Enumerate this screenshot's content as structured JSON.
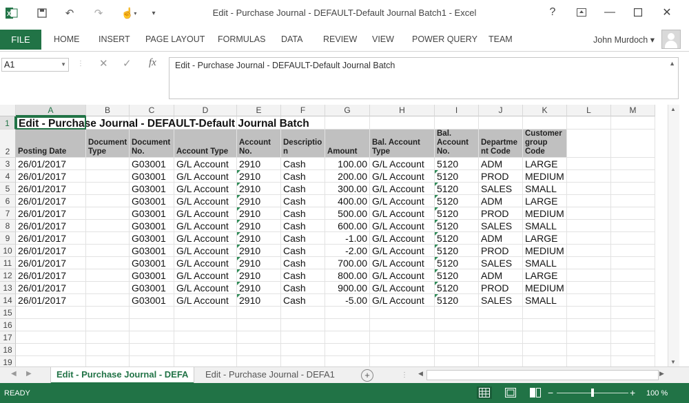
{
  "window": {
    "title": "Edit - Purchase Journal - DEFAULT-Default Journal Batch1 - Excel",
    "help": "?"
  },
  "ribbon": {
    "file": "FILE",
    "tabs": [
      "HOME",
      "INSERT",
      "PAGE LAYOUT",
      "FORMULAS",
      "DATA",
      "REVIEW",
      "VIEW",
      "POWER QUERY",
      "TEAM"
    ],
    "user": "John Murdoch ▾"
  },
  "formula_bar": {
    "name_box": "A1",
    "fx": "fx",
    "content": "Edit - Purchase Journal - DEFAULT-Default Journal Batch"
  },
  "sheet": {
    "columns": [
      "A",
      "B",
      "C",
      "D",
      "E",
      "F",
      "G",
      "H",
      "I",
      "J",
      "K",
      "L",
      "M"
    ],
    "row_numbers": [
      "1",
      "2",
      "3",
      "4",
      "5",
      "6",
      "7",
      "8",
      "9",
      "10",
      "11",
      "12",
      "13",
      "14",
      "15",
      "16",
      "17",
      "18",
      "19"
    ],
    "title": "Edit - Purchase Journal - DEFAULT-Default Journal Batch",
    "headers": [
      "Posting Date",
      "Document Type",
      "Document No.",
      "Account Type",
      "Account No.",
      "Descriptio n",
      "Amount",
      "Bal. Account Type",
      "Bal. Account No.",
      "Departme nt Code",
      "Customer group Code"
    ],
    "rows": [
      [
        "26/01/2017",
        "",
        "G03001",
        "G/L Account",
        "2910",
        "Cash",
        "100.00",
        "G/L Account",
        "5120",
        "ADM",
        "LARGE"
      ],
      [
        "26/01/2017",
        "",
        "G03001",
        "G/L Account",
        "2910",
        "Cash",
        "200.00",
        "G/L Account",
        "5120",
        "PROD",
        "MEDIUM"
      ],
      [
        "26/01/2017",
        "",
        "G03001",
        "G/L Account",
        "2910",
        "Cash",
        "300.00",
        "G/L Account",
        "5120",
        "SALES",
        "SMALL"
      ],
      [
        "26/01/2017",
        "",
        "G03001",
        "G/L Account",
        "2910",
        "Cash",
        "400.00",
        "G/L Account",
        "5120",
        "ADM",
        "LARGE"
      ],
      [
        "26/01/2017",
        "",
        "G03001",
        "G/L Account",
        "2910",
        "Cash",
        "500.00",
        "G/L Account",
        "5120",
        "PROD",
        "MEDIUM"
      ],
      [
        "26/01/2017",
        "",
        "G03001",
        "G/L Account",
        "2910",
        "Cash",
        "600.00",
        "G/L Account",
        "5120",
        "SALES",
        "SMALL"
      ],
      [
        "26/01/2017",
        "",
        "G03001",
        "G/L Account",
        "2910",
        "Cash",
        "-1.00",
        "G/L Account",
        "5120",
        "ADM",
        "LARGE"
      ],
      [
        "26/01/2017",
        "",
        "G03001",
        "G/L Account",
        "2910",
        "Cash",
        "-2.00",
        "G/L Account",
        "5120",
        "PROD",
        "MEDIUM"
      ],
      [
        "26/01/2017",
        "",
        "G03001",
        "G/L Account",
        "2910",
        "Cash",
        "700.00",
        "G/L Account",
        "5120",
        "SALES",
        "SMALL"
      ],
      [
        "26/01/2017",
        "",
        "G03001",
        "G/L Account",
        "2910",
        "Cash",
        "800.00",
        "G/L Account",
        "5120",
        "ADM",
        "LARGE"
      ],
      [
        "26/01/2017",
        "",
        "G03001",
        "G/L Account",
        "2910",
        "Cash",
        "900.00",
        "G/L Account",
        "5120",
        "PROD",
        "MEDIUM"
      ],
      [
        "26/01/2017",
        "",
        "G03001",
        "G/L Account",
        "2910",
        "Cash",
        "-5.00",
        "G/L Account",
        "5120",
        "SALES",
        "SMALL"
      ]
    ]
  },
  "sheet_tabs": [
    "Edit - Purchase Journal - DEFA",
    "Edit - Purchase Journal - DEFA1"
  ],
  "status": {
    "ready": "READY",
    "zoom": "100 %"
  },
  "colors": {
    "accent": "#217346",
    "header_fill": "#c0c0c0"
  }
}
